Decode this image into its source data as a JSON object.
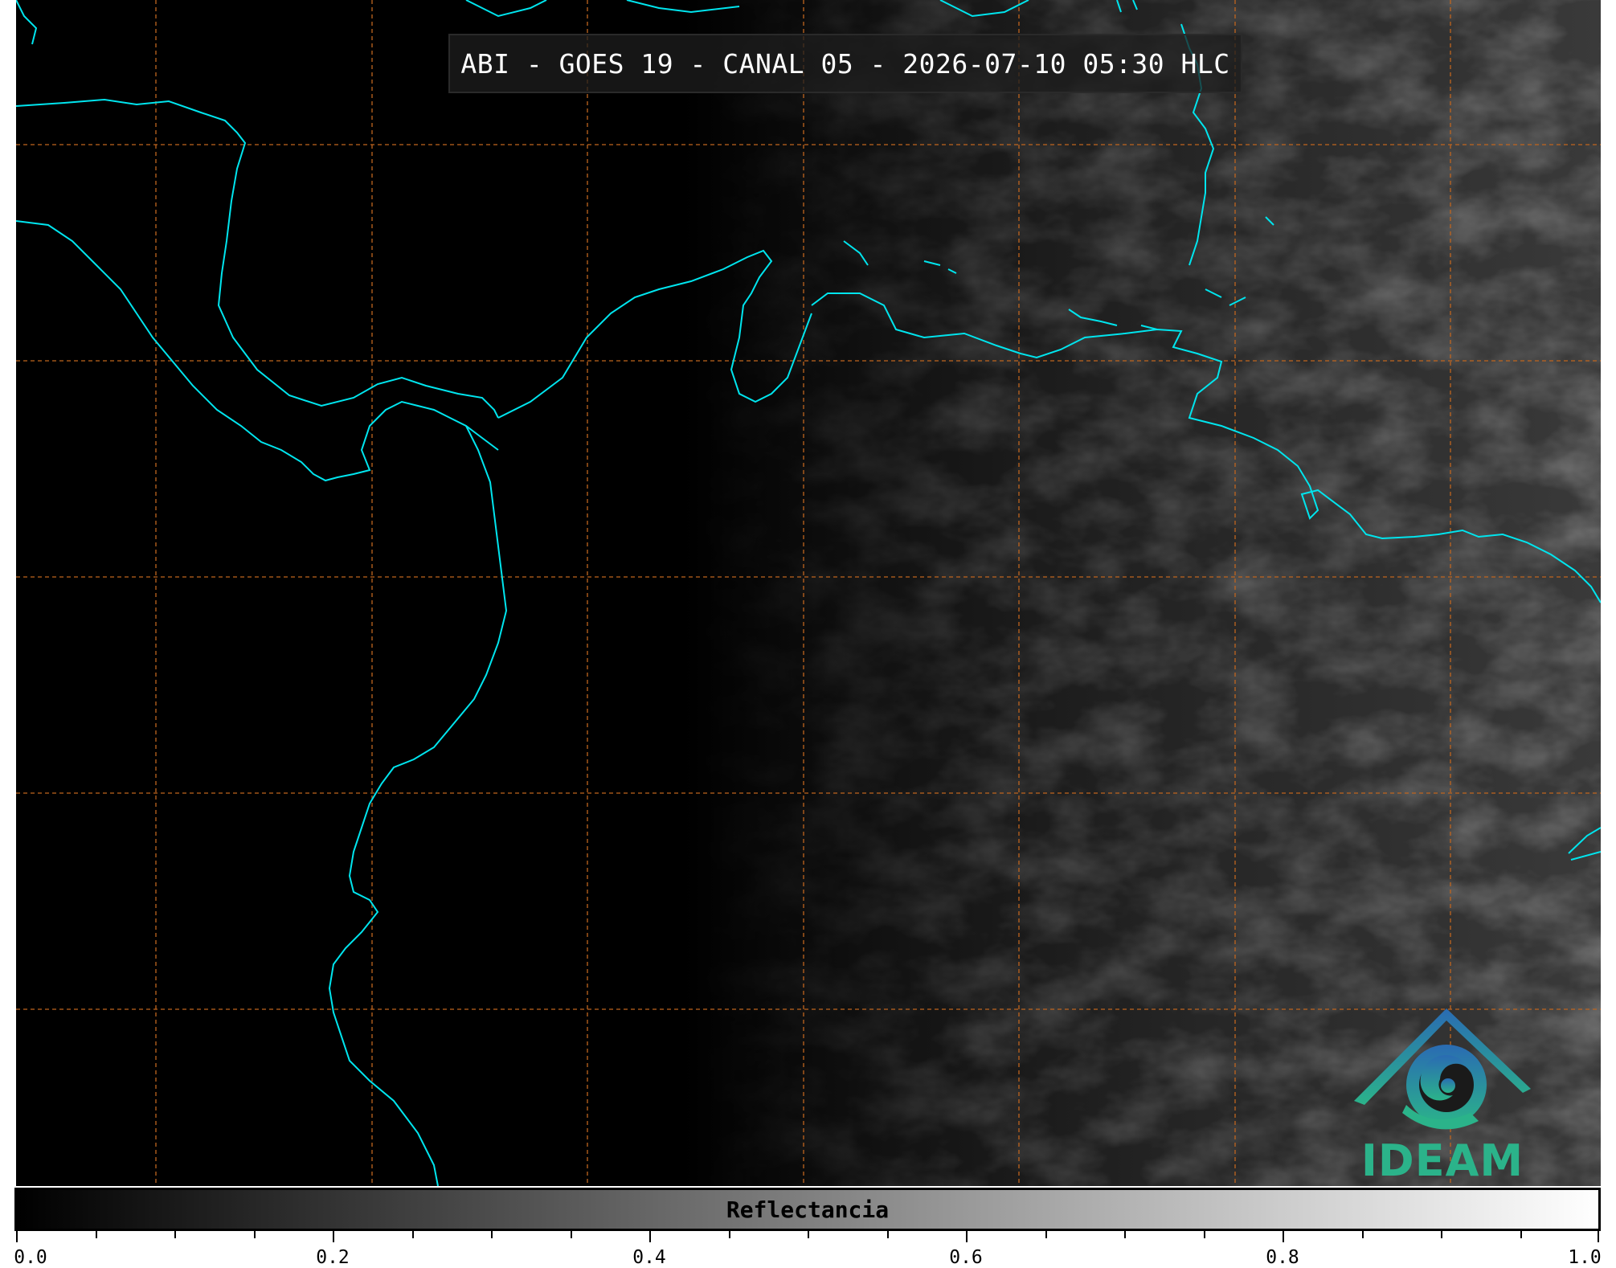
{
  "title": "ABI - GOES 19 - CANAL 05 - 2026-07-10 05:30 HLC",
  "logo": {
    "text": "IDEAM",
    "icon": "ideam-logo-icon"
  },
  "colorbar": {
    "label": "Reflectancia",
    "min": 0.0,
    "max": 1.0,
    "ticks": [
      "0.0",
      "0.2",
      "0.4",
      "0.6",
      "0.8",
      "1.0"
    ],
    "tick_values": [
      0.0,
      0.2,
      0.4,
      0.6,
      0.8,
      1.0
    ],
    "minor_step": 0.05,
    "gradient": [
      "#000000",
      "#ffffff"
    ]
  },
  "colors": {
    "coastline": "#00e5ee",
    "gridline": "#c0651e",
    "logo_blue": "#2a6bb3",
    "logo_green": "#2bb38a"
  }
}
